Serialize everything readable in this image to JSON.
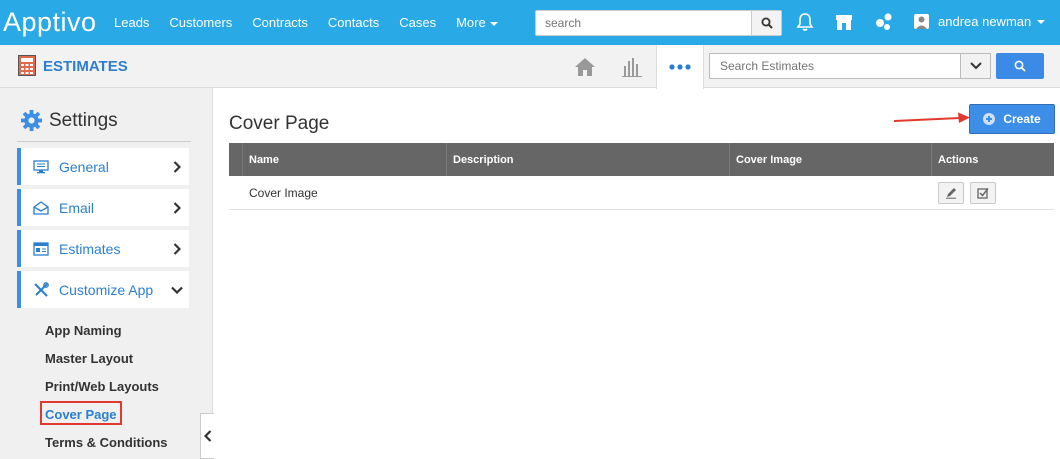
{
  "brand": {
    "logo": "Apptivo"
  },
  "topnav": {
    "items": [
      "Leads",
      "Customers",
      "Contracts",
      "Contacts",
      "Cases",
      "More"
    ],
    "search_placeholder": "search",
    "user_name": "andrea newman"
  },
  "app": {
    "title": "ESTIMATES",
    "search_placeholder": "Search Estimates"
  },
  "sidebar": {
    "heading": "Settings",
    "menu": [
      {
        "label": "General",
        "icon": "monitor-icon",
        "expanded": false
      },
      {
        "label": "Email",
        "icon": "envelope-icon",
        "expanded": false
      },
      {
        "label": "Estimates",
        "icon": "estimates-icon",
        "expanded": false
      },
      {
        "label": "Customize App",
        "icon": "tools-icon",
        "expanded": true
      }
    ],
    "sublinks": [
      "App Naming",
      "Master Layout",
      "Print/Web Layouts",
      "Cover Page",
      "Terms & Conditions"
    ],
    "active_sublink": "Cover Page"
  },
  "main": {
    "title": "Cover Page",
    "create_label": "Create",
    "table": {
      "headers": [
        "Name",
        "Description",
        "Cover Image",
        "Actions"
      ],
      "rows": [
        {
          "name": "Cover Image",
          "description": "",
          "cover_image": ""
        }
      ]
    }
  },
  "colors": {
    "topbar": "#29a9e6",
    "accent": "#3d8ee6",
    "highlight_box": "#e03a2f",
    "table_header": "#666666"
  }
}
